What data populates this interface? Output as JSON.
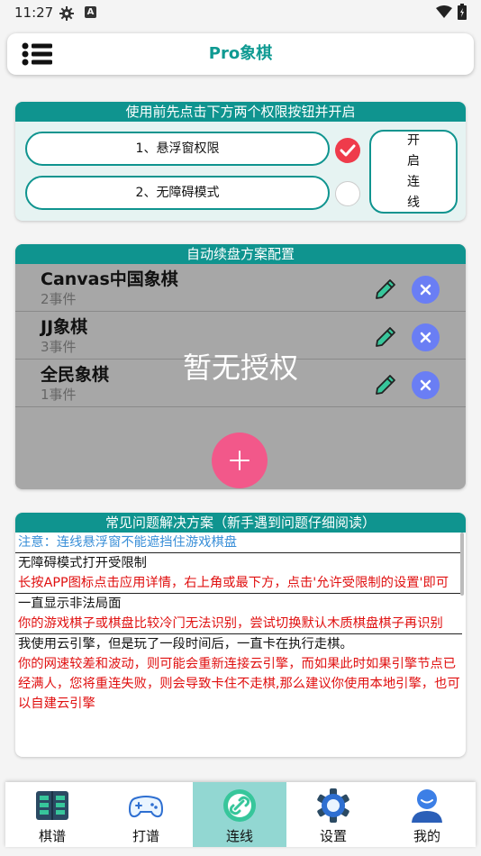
{
  "status_bar": {
    "time": "11:27",
    "a_label": "A"
  },
  "app_bar": {
    "title": "Pro象棋"
  },
  "permissions": {
    "header": "使用前先点击下方两个权限按钮并开启",
    "floating_window": {
      "label": "1、悬浮窗权限",
      "enabled": true
    },
    "accessibility": {
      "label": "2、无障碍模式",
      "enabled": false
    },
    "connect_label": "开启连线"
  },
  "schemes": {
    "header": "自动续盘方案配置",
    "watermark": "暂无授权",
    "items": [
      {
        "name": "Canvas中国象棋",
        "count": "2事件"
      },
      {
        "name": "JJ象棋",
        "count": "3事件"
      },
      {
        "name": "全民象棋",
        "count": "1事件"
      }
    ]
  },
  "faq": {
    "header": "常见问题解决方案（新手遇到问题仔细阅读）",
    "note": "注意：连线悬浮窗不能遮挡住游戏棋盘",
    "items": [
      {
        "q": "无障碍模式打开受限制",
        "a": "长按APP图标点击应用详情，右上角或最下方，点击'允许受限制的设置'即可"
      },
      {
        "q": "一直显示非法局面",
        "a": "你的游戏棋子或棋盘比较冷门无法识别，尝试切换默认木质棋盘棋子再识别"
      },
      {
        "q": "我使用云引擎，但是玩了一段时间后，一直卡在执行走棋。",
        "a": "你的网速较差和波动，则可能会重新连接云引擎，而如果此时如果引擎节点已经满人，您将重连失败，则会导致卡住不走棋,那么建议你使用本地引擎，也可以自建云引擎"
      }
    ]
  },
  "nav": {
    "active": "连线",
    "items": [
      {
        "label": "棋谱",
        "icon": "book-icon"
      },
      {
        "label": "打谱",
        "icon": "gamepad-icon"
      },
      {
        "label": "连线",
        "icon": "link-icon"
      },
      {
        "label": "设置",
        "icon": "gear-icon"
      },
      {
        "label": "我的",
        "icon": "user-icon"
      }
    ]
  },
  "colors": {
    "teal": "#0f948f",
    "title": "#0f9a92",
    "danger": "#e01010",
    "note": "#3a8fd8",
    "check": "#ef3b4b",
    "fab": "#f2588a",
    "x_button": "#6a7ef4"
  }
}
